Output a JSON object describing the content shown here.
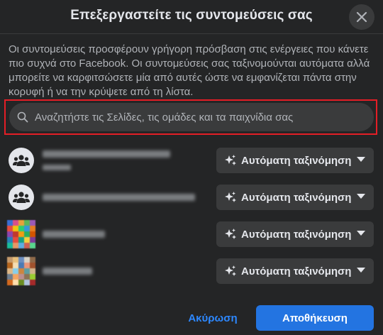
{
  "dialog": {
    "title": "Επεξεργαστείτε τις συντομεύσεις σας",
    "close_icon": "close-icon",
    "description": "Οι συντομεύσεις προσφέρουν γρήγορη πρόσβαση στις ενέργειες που κάνετε πιο συχνά στο Facebook. Οι συντομεύσεις σας ταξινομούνται αυτόματα αλλά μπορείτε να καρφιτσώσετε μία από αυτές ώστε να εμφανίζεται πάντα στην κορυφή ή να την κρύψετε από τη λίστα."
  },
  "search": {
    "placeholder": "Αναζητήστε τις Σελίδες, τις ομάδες και τα παιχνίδια σας",
    "icon": "search-icon",
    "highlight_color": "#e41e26"
  },
  "shortcuts": [
    {
      "kind": "group",
      "icon": "group-icon",
      "sort_label": "Αυτόματη ταξινόμηση"
    },
    {
      "kind": "group",
      "icon": "group-icon",
      "sort_label": "Αυτόματη ταξινόμηση"
    },
    {
      "kind": "game",
      "icon": "game-thumbnail",
      "sort_label": "Αυτόματη ταξινόμηση"
    },
    {
      "kind": "game",
      "icon": "game-thumbnail",
      "sort_label": "Αυτόματη ταξινόμηση"
    }
  ],
  "footer": {
    "cancel_label": "Ακύρωση",
    "save_label": "Αποθήκευση"
  },
  "colors": {
    "background": "#242526",
    "surface": "#3a3b3c",
    "primary": "#2374e1",
    "link": "#2d88ff",
    "text_primary": "#e4e6eb",
    "text_secondary": "#b0b3b8"
  }
}
